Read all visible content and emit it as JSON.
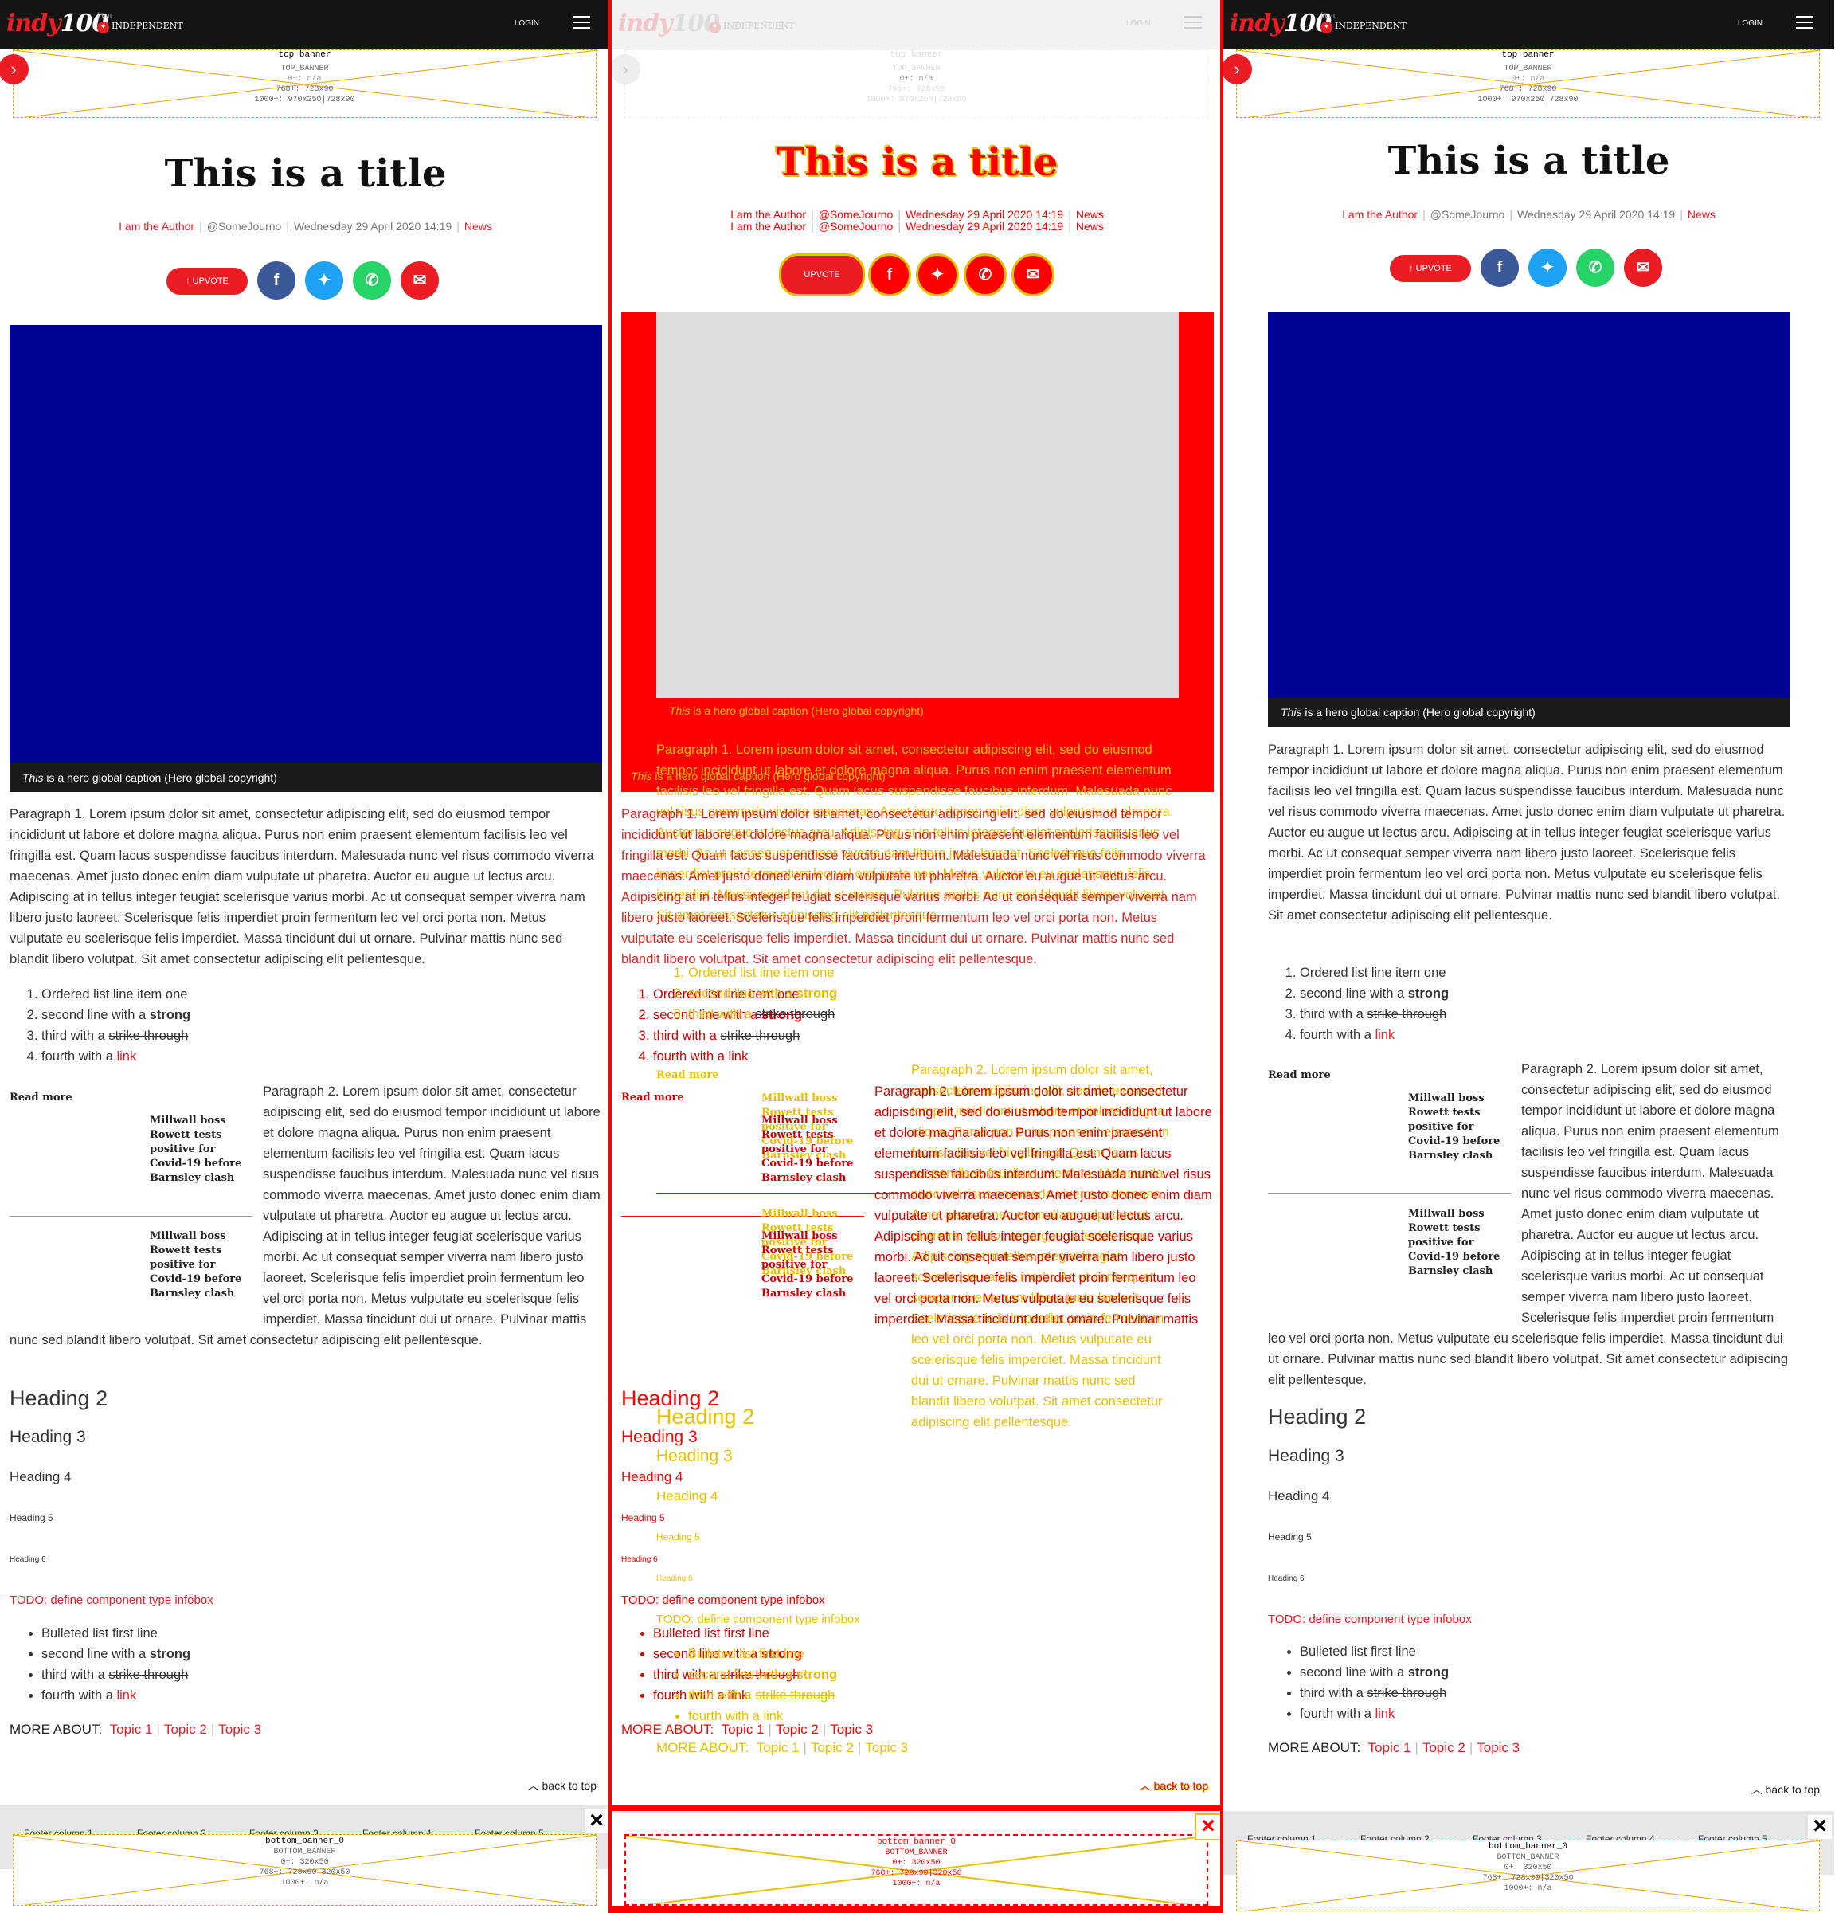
{
  "header": {
    "logo_text": "indy",
    "logo_num": "100",
    "from": "from",
    "partner": "INDEPENDENT",
    "login": "LOGIN"
  },
  "top_banner": {
    "name": "top_banner",
    "id": "TOP_BANNER",
    "size0": "0+: n/a",
    "size768": "768+: 728x90",
    "size1000": "1000+: 970x250|728x90"
  },
  "article": {
    "title": "This is a title",
    "author": "I am the Author",
    "handle": "@SomeJourno",
    "date": "Wednesday 29 April 2020 14:19",
    "section": "News",
    "upvote": "UPVOTE",
    "caption_em": "This",
    "caption_rest": " is a hero global caption (Hero global copyright)",
    "para1": "Paragraph 1. Lorem ipsum dolor sit amet, consectetur adipiscing elit, sed do eiusmod tempor incididunt ut labore et dolore magna aliqua. Purus non enim praesent elementum facilisis leo vel fringilla est. Quam lacus suspendisse faucibus interdum. Malesuada nunc vel risus commodo viverra maecenas. Amet justo donec enim diam vulputate ut pharetra. Auctor eu augue ut lectus arcu. Adipiscing at in tellus integer feugiat scelerisque varius morbi. Ac ut consequat semper viverra nam libero justo laoreet. Scelerisque felis imperdiet proin fermentum leo vel orci porta non. Metus vulputate eu scelerisque felis imperdiet. Massa tincidunt dui ut ornare. Pulvinar mattis nunc sed blandit libero volutpat. Sit amet consectetur adipiscing elit pellentesque.",
    "ol": {
      "i1": "Ordered list line item one",
      "i2": "second line with a ",
      "i2b": "strong",
      "i3": "third with a ",
      "i3s": "strike through",
      "i4": "fourth with a ",
      "i4l": "link"
    },
    "read_more": "Read more",
    "rm1": "Millwall boss Rowett tests positive for Covid-19 before Barnsley clash",
    "rm2": "Millwall boss Rowett tests positive for Covid-19 before Barnsley clash",
    "para2": "Paragraph 2. Lorem ipsum dolor sit amet, consectetur adipiscing elit, sed do eiusmod tempor incididunt ut labore et dolore magna aliqua. Purus non enim praesent elementum facilisis leo vel fringilla est. Quam lacus suspendisse faucibus interdum. Malesuada nunc vel risus commodo viverra maecenas. Amet justo donec enim diam vulputate ut pharetra. Auctor eu augue ut lectus arcu. Adipiscing at in tellus integer feugiat scelerisque varius morbi. Ac ut consequat semper viverra nam libero justo laoreet. Scelerisque felis imperdiet proin fermentum leo vel orci porta non. Metus vulputate eu scelerisque felis imperdiet. Massa tincidunt dui ut ornare. Pulvinar mattis nunc sed blandit libero volutpat. Sit amet consectetur adipiscing elit pellentesque.",
    "h2": "Heading 2",
    "h3": "Heading 3",
    "h4": "Heading 4",
    "h5": "Heading 5",
    "h6": "Heading 6",
    "todo": "TODO: define component type infobox",
    "ul": {
      "i1": "Bulleted list first line",
      "i2": "second line with a ",
      "i2b": "strong",
      "i3": "third with a ",
      "i3s": "strike through",
      "i4": "fourth with a ",
      "i4l": "link"
    },
    "more_about": "MORE ABOUT:",
    "topics": [
      "Topic 1",
      "Topic 2",
      "Topic 3"
    ],
    "back_to_top": "back to top"
  },
  "footer": {
    "cols": [
      "Footer column 1",
      "Footer column 2",
      "Footer column 3",
      "Footer column 4",
      "Footer column 5"
    ]
  },
  "bottom_banner": {
    "name": "bottom_banner_0",
    "id": "BOTTOM_BANNER",
    "size0": "0+: 320x50",
    "size768": "768+: 728x90|320x50",
    "size1000": "1000+: n/a"
  },
  "colors": {
    "brand": "#ec1c24",
    "hero": "#020394",
    "header": "#141414",
    "diff": "#ff0000",
    "diff_yellow": "#e8c000"
  }
}
